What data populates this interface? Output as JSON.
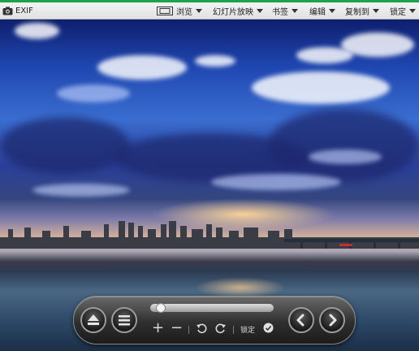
{
  "toolbar": {
    "exif_label": "EXIF",
    "browse_label": "浏览",
    "slideshow_label": "幻灯片放映",
    "bookmarks_label": "书签",
    "edit_label": "编辑",
    "copy_to_label": "复制到",
    "lock_label": "锁定"
  },
  "controls": {
    "lock_label": "锁定",
    "slider_position": 0.05
  },
  "colors": {
    "accent_bar": "#1aa34a",
    "panel_bg": "#2f2f2f"
  }
}
